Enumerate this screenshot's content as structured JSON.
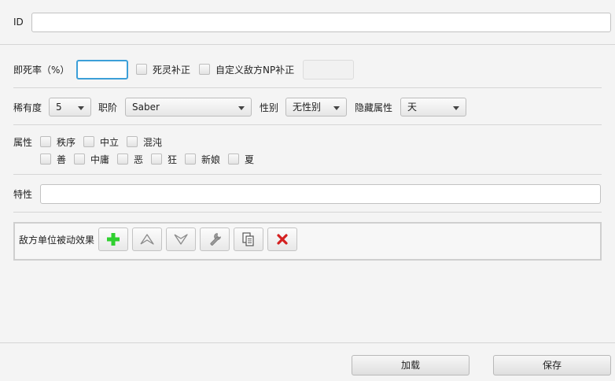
{
  "id_field": {
    "label": "ID",
    "value": ""
  },
  "death_rate": {
    "label": "即死率（%）",
    "value": "",
    "undead_label": "死灵补正",
    "custom_np_label": "自定义敌方NP补正",
    "custom_np_value": ""
  },
  "rarity": {
    "label": "稀有度",
    "value": "5"
  },
  "class_field": {
    "label": "职阶",
    "value": "Saber"
  },
  "gender": {
    "label": "性别",
    "value": "无性别"
  },
  "hidden_attr": {
    "label": "隐藏属性",
    "value": "天"
  },
  "attributes": {
    "label": "属性",
    "row1": [
      "秩序",
      "中立",
      "混沌"
    ],
    "row2": [
      "善",
      "中庸",
      "恶",
      "狂",
      "新娘",
      "夏"
    ]
  },
  "traits": {
    "label": "特性",
    "value": ""
  },
  "passive": {
    "label": "敌方单位被动效果"
  },
  "footer": {
    "load_label": "加载",
    "save_label": "保存"
  },
  "icons": {
    "add": "plus-icon",
    "up": "arrow-up-icon",
    "down": "arrow-down-icon",
    "edit": "wrench-icon",
    "copy": "copy-icon",
    "delete": "delete-icon"
  },
  "colors": {
    "accent": "#3c9fd8",
    "add_green": "#2fd02f",
    "delete_red": "#d42020"
  }
}
